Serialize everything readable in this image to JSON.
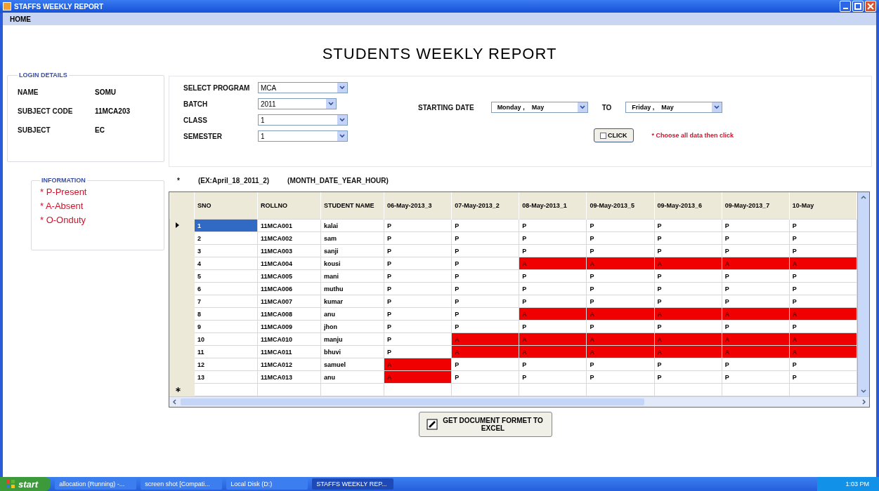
{
  "window": {
    "title": "STAFFS WEEKLY REPORT"
  },
  "menu": [
    "HOME"
  ],
  "heading": "STUDENTS WEEKLY REPORT",
  "login_details": {
    "title": "LOGIN DETAILS",
    "fields": [
      {
        "label": "NAME",
        "value": "SOMU"
      },
      {
        "label": "SUBJECT CODE",
        "value": "11MCA203"
      },
      {
        "label": "SUBJECT",
        "value": "EC"
      }
    ]
  },
  "filters": [
    {
      "label": "SELECT PROGRAM",
      "value": "MCA"
    },
    {
      "label": "BATCH",
      "value": "2011"
    },
    {
      "label": "CLASS",
      "value": "1"
    },
    {
      "label": "SEMESTER",
      "value": "1"
    }
  ],
  "date_range": {
    "label": "STARTING DATE",
    "from_day": "Monday",
    "from_sep": ",",
    "from_month": "May",
    "to_label": "TO",
    "to_day": "Friday",
    "to_sep": ",",
    "to_month": "May"
  },
  "click_button": "CLICK",
  "hint": "* Choose all data then click",
  "information": {
    "title": "INFORMATION",
    "items": [
      "* P-Present",
      "* A-Absent",
      "* O-Onduty"
    ]
  },
  "format_note": {
    "mark": "*",
    "example": "(EX:April_18_2011_2)",
    "pattern": "(MONTH_DATE_YEAR_HOUR)"
  },
  "table": {
    "columns": [
      "SNO",
      "ROLLNO",
      "STUDENT NAME",
      "06-May-2013_3",
      "07-May-2013_2",
      "08-May-2013_1",
      "09-May-2013_5",
      "09-May-2013_6",
      "09-May-2013_7",
      "10-May"
    ],
    "rows": [
      {
        "selected": true,
        "cells": [
          {
            "text": "1"
          },
          {
            "text": "11MCA001"
          },
          {
            "text": "kalai"
          },
          {
            "text": "P",
            "absent": false
          },
          {
            "text": "P",
            "absent": false
          },
          {
            "text": "P",
            "absent": false
          },
          {
            "text": "P",
            "absent": false
          },
          {
            "text": "P",
            "absent": false
          },
          {
            "text": "P",
            "absent": false
          },
          {
            "text": "P",
            "absent": false
          }
        ]
      },
      {
        "selected": false,
        "cells": [
          {
            "text": "2"
          },
          {
            "text": "11MCA002"
          },
          {
            "text": "sam"
          },
          {
            "text": "P",
            "absent": false
          },
          {
            "text": "P",
            "absent": false
          },
          {
            "text": "P",
            "absent": false
          },
          {
            "text": "P",
            "absent": false
          },
          {
            "text": "P",
            "absent": false
          },
          {
            "text": "P",
            "absent": false
          },
          {
            "text": "P",
            "absent": false
          }
        ]
      },
      {
        "selected": false,
        "cells": [
          {
            "text": "3"
          },
          {
            "text": "11MCA003"
          },
          {
            "text": "sanji"
          },
          {
            "text": "P",
            "absent": false
          },
          {
            "text": "P",
            "absent": false
          },
          {
            "text": "P",
            "absent": false
          },
          {
            "text": "P",
            "absent": false
          },
          {
            "text": "P",
            "absent": false
          },
          {
            "text": "P",
            "absent": false
          },
          {
            "text": "P",
            "absent": false
          }
        ]
      },
      {
        "selected": false,
        "cells": [
          {
            "text": "4"
          },
          {
            "text": "11MCA004"
          },
          {
            "text": "kousi"
          },
          {
            "text": "P",
            "absent": false
          },
          {
            "text": "P",
            "absent": false
          },
          {
            "text": "A",
            "absent": true
          },
          {
            "text": "A",
            "absent": true
          },
          {
            "text": "A",
            "absent": true
          },
          {
            "text": "A",
            "absent": true
          },
          {
            "text": "A",
            "absent": true
          }
        ]
      },
      {
        "selected": false,
        "cells": [
          {
            "text": "5"
          },
          {
            "text": "11MCA005"
          },
          {
            "text": "mani"
          },
          {
            "text": "P",
            "absent": false
          },
          {
            "text": "P",
            "absent": false
          },
          {
            "text": "P",
            "absent": false
          },
          {
            "text": "P",
            "absent": false
          },
          {
            "text": "P",
            "absent": false
          },
          {
            "text": "P",
            "absent": false
          },
          {
            "text": "P",
            "absent": false
          }
        ]
      },
      {
        "selected": false,
        "cells": [
          {
            "text": "6"
          },
          {
            "text": "11MCA006"
          },
          {
            "text": "muthu"
          },
          {
            "text": "P",
            "absent": false
          },
          {
            "text": "P",
            "absent": false
          },
          {
            "text": "P",
            "absent": false
          },
          {
            "text": "P",
            "absent": false
          },
          {
            "text": "P",
            "absent": false
          },
          {
            "text": "P",
            "absent": false
          },
          {
            "text": "P",
            "absent": false
          }
        ]
      },
      {
        "selected": false,
        "cells": [
          {
            "text": "7"
          },
          {
            "text": "11MCA007"
          },
          {
            "text": "kumar"
          },
          {
            "text": "P",
            "absent": false
          },
          {
            "text": "P",
            "absent": false
          },
          {
            "text": "P",
            "absent": false
          },
          {
            "text": "P",
            "absent": false
          },
          {
            "text": "P",
            "absent": false
          },
          {
            "text": "P",
            "absent": false
          },
          {
            "text": "P",
            "absent": false
          }
        ]
      },
      {
        "selected": false,
        "cells": [
          {
            "text": "8"
          },
          {
            "text": "11MCA008"
          },
          {
            "text": "anu"
          },
          {
            "text": "P",
            "absent": false
          },
          {
            "text": "P",
            "absent": false
          },
          {
            "text": "A",
            "absent": true
          },
          {
            "text": "A",
            "absent": true
          },
          {
            "text": "A",
            "absent": true
          },
          {
            "text": "A",
            "absent": true
          },
          {
            "text": "A",
            "absent": true
          }
        ]
      },
      {
        "selected": false,
        "cells": [
          {
            "text": "9"
          },
          {
            "text": "11MCA009"
          },
          {
            "text": "jhon"
          },
          {
            "text": "P",
            "absent": false
          },
          {
            "text": "P",
            "absent": false
          },
          {
            "text": "P",
            "absent": false
          },
          {
            "text": "P",
            "absent": false
          },
          {
            "text": "P",
            "absent": false
          },
          {
            "text": "P",
            "absent": false
          },
          {
            "text": "P",
            "absent": false
          }
        ]
      },
      {
        "selected": false,
        "cells": [
          {
            "text": "10"
          },
          {
            "text": "11MCA010"
          },
          {
            "text": "manju"
          },
          {
            "text": "P",
            "absent": false
          },
          {
            "text": "A",
            "absent": true
          },
          {
            "text": "A",
            "absent": true
          },
          {
            "text": "A",
            "absent": true
          },
          {
            "text": "A",
            "absent": true
          },
          {
            "text": "A",
            "absent": true
          },
          {
            "text": "A",
            "absent": true
          }
        ]
      },
      {
        "selected": false,
        "cells": [
          {
            "text": "11"
          },
          {
            "text": "11MCA011"
          },
          {
            "text": "bhuvi"
          },
          {
            "text": "P",
            "absent": false
          },
          {
            "text": "A",
            "absent": true
          },
          {
            "text": "A",
            "absent": true
          },
          {
            "text": "A",
            "absent": true
          },
          {
            "text": "A",
            "absent": true
          },
          {
            "text": "A",
            "absent": true
          },
          {
            "text": "A",
            "absent": true
          }
        ]
      },
      {
        "selected": false,
        "cells": [
          {
            "text": "12"
          },
          {
            "text": "11MCA012"
          },
          {
            "text": "samuel"
          },
          {
            "text": "A",
            "absent": true
          },
          {
            "text": "P",
            "absent": false
          },
          {
            "text": "P",
            "absent": false
          },
          {
            "text": "P",
            "absent": false
          },
          {
            "text": "P",
            "absent": false
          },
          {
            "text": "P",
            "absent": false
          },
          {
            "text": "P",
            "absent": false
          }
        ]
      },
      {
        "selected": false,
        "cells": [
          {
            "text": "13"
          },
          {
            "text": "11MCA013"
          },
          {
            "text": "anu"
          },
          {
            "text": "A",
            "absent": true
          },
          {
            "text": "P",
            "absent": false
          },
          {
            "text": "P",
            "absent": false
          },
          {
            "text": "P",
            "absent": false
          },
          {
            "text": "P",
            "absent": false
          },
          {
            "text": "P",
            "absent": false
          },
          {
            "text": "P",
            "absent": false
          }
        ]
      }
    ]
  },
  "export_button": "GET DOCUMENT FORMET TO EXCEL",
  "taskbar": {
    "start": "start",
    "items": [
      {
        "label": "allocation (Running) -...",
        "selected": false
      },
      {
        "label": "screen shot [Compati...",
        "selected": false
      },
      {
        "label": "Local Disk (D:)",
        "selected": false
      },
      {
        "label": "STAFFS WEEKLY REP...",
        "selected": true
      }
    ],
    "clock": "1:03 PM"
  }
}
